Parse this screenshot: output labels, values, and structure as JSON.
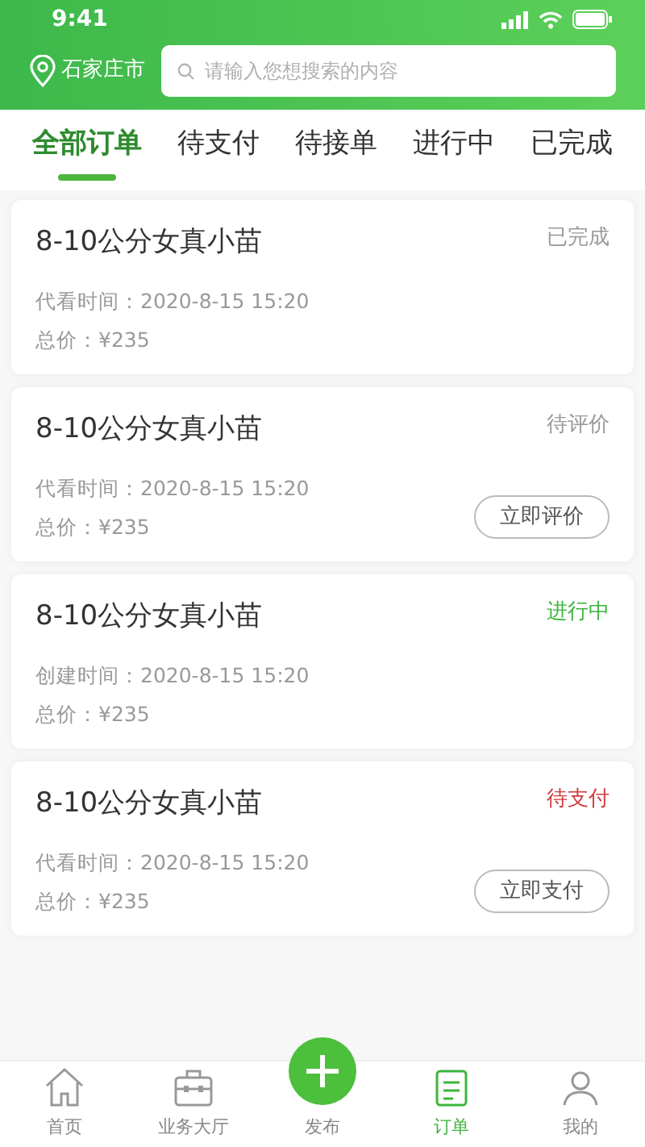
{
  "status_bar": {
    "time": "9:41"
  },
  "header": {
    "city": "石家庄市",
    "search": {
      "placeholder": "请输入您想搜索的内容"
    }
  },
  "tabs": [
    {
      "label": "全部订单",
      "selected": true
    },
    {
      "label": "待支付",
      "selected": false
    },
    {
      "label": "待接单",
      "selected": false
    },
    {
      "label": "进行中",
      "selected": false
    },
    {
      "label": "已完成",
      "selected": false
    }
  ],
  "orders": [
    {
      "title": "8-10公分女真小苗",
      "status": "已完成",
      "color": "#999999",
      "time_label": "代看时间：",
      "time": "2020-8-15  15:20",
      "price_label": "总价：",
      "price": "¥235"
    },
    {
      "title": "8-10公分女真小苗",
      "status": "待评价",
      "color": "#999999",
      "time_label": "代看时间：",
      "time": "2020-8-15  15:20",
      "price_label": "总价：",
      "price": "¥235",
      "action": "立即评价"
    },
    {
      "title": "8-10公分女真小苗",
      "status": "进行中",
      "color": "#3cb53c",
      "time_label": "创建时间：",
      "time": "2020-8-15  15:20",
      "price_label": "总价：",
      "price": "¥235"
    },
    {
      "title": "8-10公分女真小苗",
      "status": "待支付",
      "color": "#d03a3a",
      "time_label": "代看时间：",
      "time": "2020-8-15  15:20",
      "price_label": "总价：",
      "price": "¥235",
      "action": "立即支付"
    }
  ],
  "tab_bar": [
    {
      "kind": "home",
      "label": "首页",
      "selected": false
    },
    {
      "kind": "briefcase",
      "label": "业务大厅",
      "selected": false
    },
    {
      "kind": "publish",
      "label": "发布",
      "selected": false
    },
    {
      "kind": "orders",
      "label": "订单",
      "selected": true
    },
    {
      "kind": "profile",
      "label": "我的",
      "selected": false
    }
  ]
}
